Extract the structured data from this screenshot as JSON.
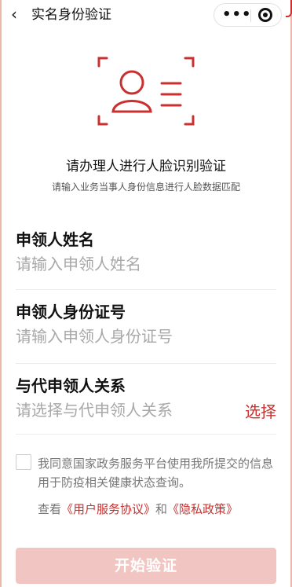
{
  "nav": {
    "back_icon": "chevron-left-icon",
    "title": "实名身份验证",
    "more_icon": "more-dots-icon",
    "close_icon": "target-circle-icon"
  },
  "intro": {
    "icon": "face-scan-icon",
    "heading": "请办理人进行人脸识别验证",
    "subheading": "请输入业务当事人身份信息进行人脸数据匹配"
  },
  "form": {
    "name": {
      "label": "申领人姓名",
      "placeholder": "请输入申领人姓名"
    },
    "id_number": {
      "label": "申领人身份证号",
      "placeholder": "请输入申领人身份证号"
    },
    "relation": {
      "label": "与代申领人关系",
      "placeholder": "请选择与代申领人关系",
      "select_label": "选择"
    }
  },
  "consent": {
    "text": "我同意国家政务服务平台使用我所提交的信息用于防疫相关健康状态查询。",
    "view_prefix": "查看",
    "user_agreement": "《用户服务协议》",
    "and": "和",
    "privacy_policy": "《隐私政策》"
  },
  "actions": {
    "start_label": "开始验证"
  },
  "colors": {
    "accent": "#c8312f",
    "button_disabled": "#f1c6c2",
    "placeholder": "#a8a8a8"
  }
}
